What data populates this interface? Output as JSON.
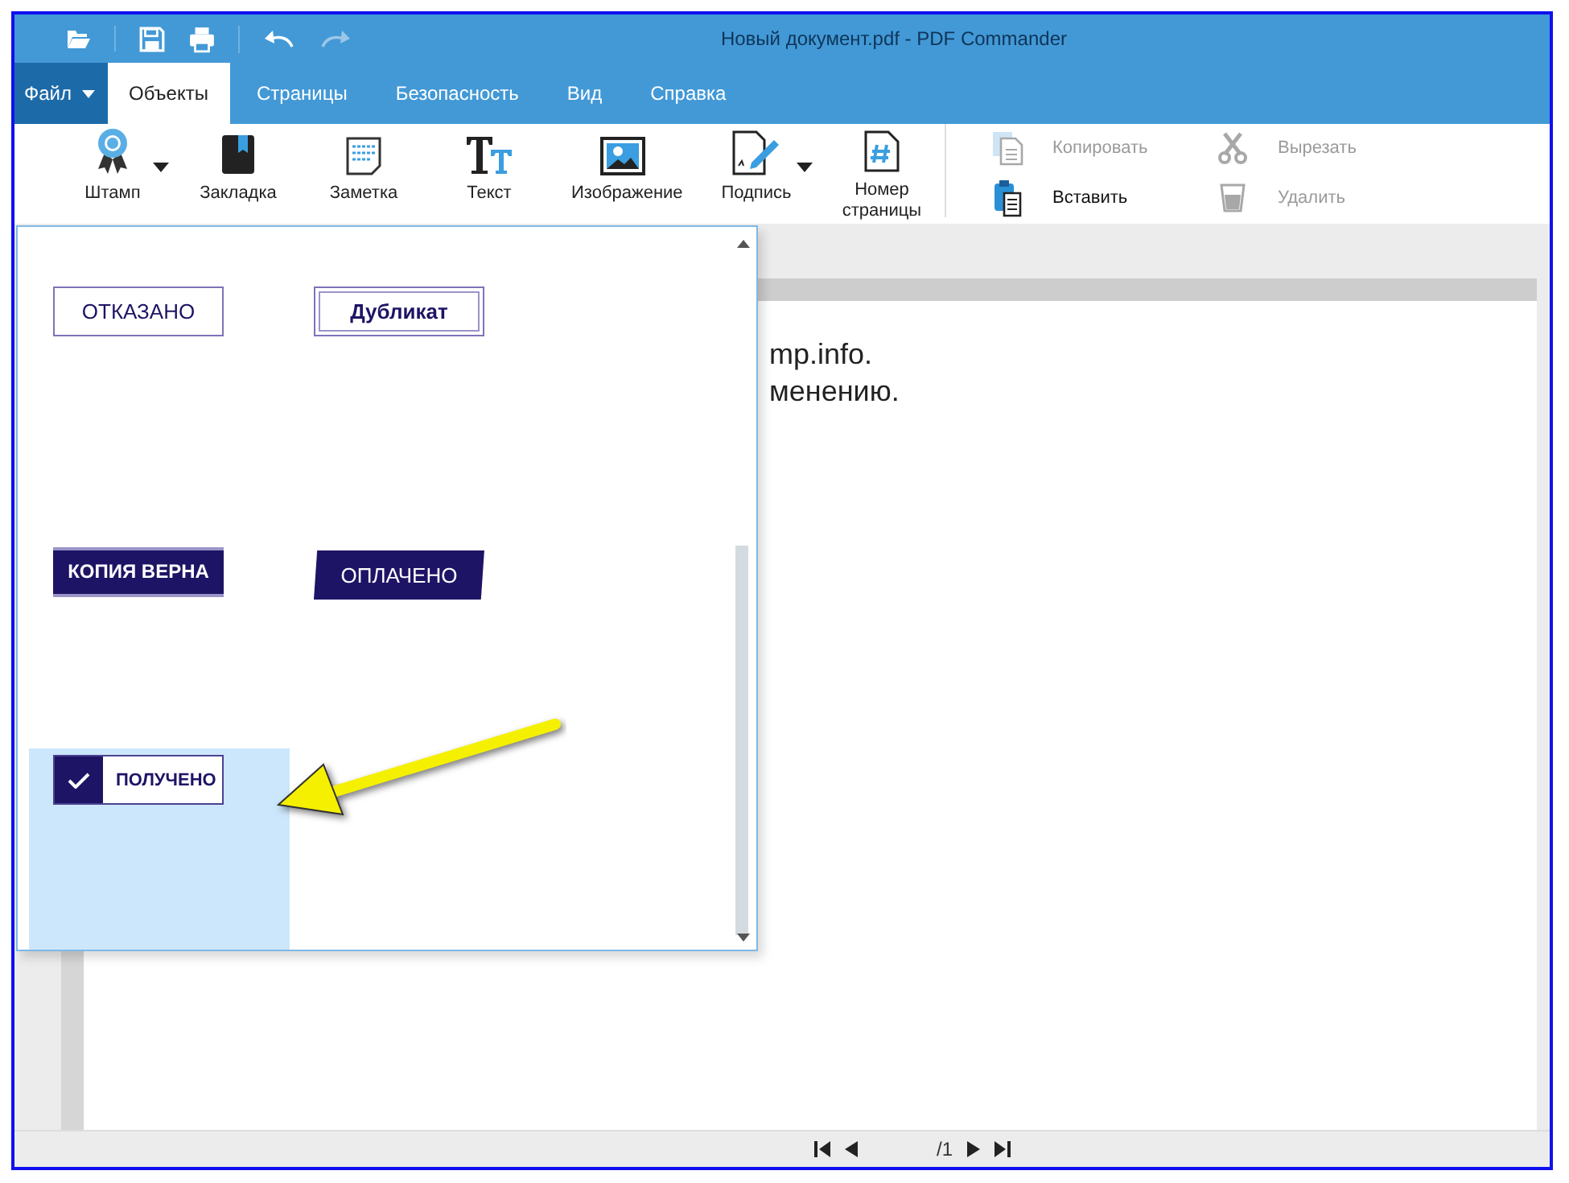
{
  "window": {
    "title": "Новый документ.pdf - PDF Commander"
  },
  "quick_access": [
    {
      "kind": "open",
      "disabled": false
    },
    {
      "kind": "save",
      "disabled": false
    },
    {
      "kind": "print",
      "disabled": false
    },
    {
      "kind": "undo",
      "disabled": false
    },
    {
      "kind": "redo",
      "disabled": true
    }
  ],
  "file_menu": {
    "label": "Файл"
  },
  "tabs": [
    {
      "label": "Объекты",
      "selected": true
    },
    {
      "label": "Страницы",
      "selected": false
    },
    {
      "label": "Безопасность",
      "selected": false
    },
    {
      "label": "Вид",
      "selected": false
    },
    {
      "label": "Справка",
      "selected": false
    }
  ],
  "ribbon": {
    "tools": [
      {
        "label": "Штамп",
        "kind": "stamp",
        "dropdown": true
      },
      {
        "label": "Закладка",
        "kind": "bookmark",
        "dropdown": false
      },
      {
        "label": "Заметка",
        "kind": "note",
        "dropdown": false
      },
      {
        "label": "Текст",
        "kind": "text",
        "dropdown": false
      },
      {
        "label": "Изображение",
        "kind": "image",
        "dropdown": false
      },
      {
        "label": "Подпись",
        "kind": "signature",
        "dropdown": true
      },
      {
        "label": "Номер страницы",
        "kind": "pagenumber",
        "dropdown": false
      }
    ],
    "edit_actions": [
      {
        "label": "Копировать",
        "kind": "copy",
        "disabled": true
      },
      {
        "label": "Вырезать",
        "kind": "cut",
        "disabled": true
      },
      {
        "label": "Вставить",
        "kind": "paste",
        "disabled": false
      },
      {
        "label": "Удалить",
        "kind": "delete",
        "disabled": true
      }
    ]
  },
  "stamps": [
    {
      "label": "ОТКАЗАНО",
      "kind": "outline",
      "selected": false
    },
    {
      "label": "Дубликат",
      "kind": "double",
      "selected": false
    },
    {
      "label": "КОПИЯ ВЕРНА",
      "kind": "filled",
      "selected": false
    },
    {
      "label": "ОПЛАЧЕНО",
      "kind": "slanted",
      "selected": false
    },
    {
      "label": "ПОЛУЧЕНО",
      "kind": "check",
      "selected": true
    }
  ],
  "document": {
    "lines": [
      "mp.info.",
      "менению."
    ]
  },
  "page_nav": {
    "total": "/1"
  }
}
